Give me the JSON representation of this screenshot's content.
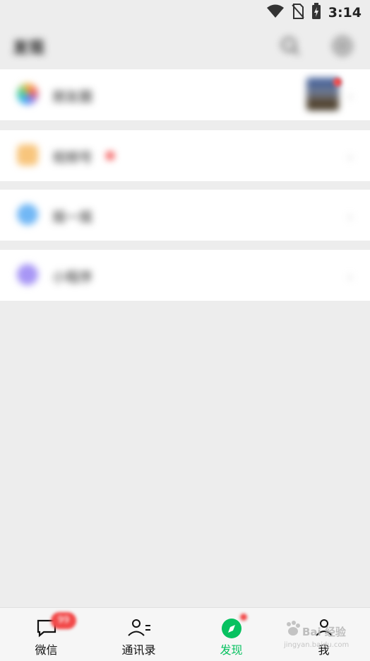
{
  "status_bar": {
    "time": "3:14",
    "icons": [
      "wifi-icon",
      "no-sim-icon",
      "battery-charging-icon"
    ]
  },
  "header": {
    "title": "发现",
    "search_icon": "search-icon",
    "add_icon": "add-circle-icon"
  },
  "menu": [
    {
      "label": "朋友圈",
      "icon": "moments-icon",
      "has_thumbnail": true
    },
    {
      "label": "视频号",
      "icon": "channels-icon",
      "has_red_dot": true
    },
    {
      "label": "摇一摇",
      "icon": "shake-icon"
    },
    {
      "label": "小程序",
      "icon": "mini-program-icon"
    }
  ],
  "tabs": [
    {
      "label": "微信",
      "icon": "chat-bubble-icon",
      "badge": "99"
    },
    {
      "label": "通讯录",
      "icon": "contacts-icon"
    },
    {
      "label": "发现",
      "icon": "compass-icon",
      "active": true
    },
    {
      "label": "我",
      "icon": "person-icon"
    }
  ],
  "watermark": {
    "text": "Bai  经验",
    "sub": "jingyan.baidu.com"
  },
  "colors": {
    "accent": "#07c160",
    "badge": "#f24a4a",
    "background": "#ededed"
  }
}
